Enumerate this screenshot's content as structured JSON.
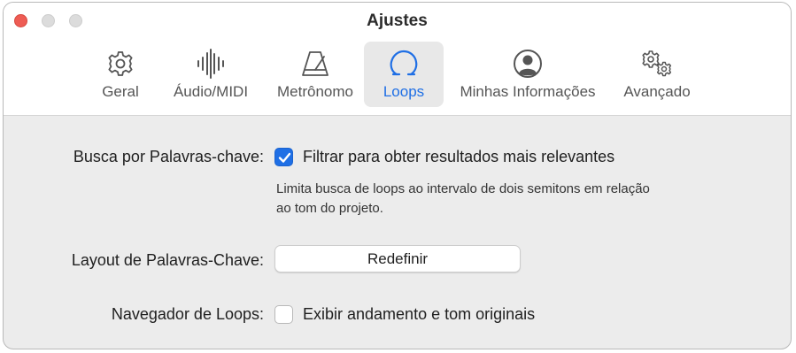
{
  "window": {
    "title": "Ajustes"
  },
  "toolbar": {
    "tabs": [
      {
        "label": "Geral",
        "icon": "gear-icon",
        "active": false
      },
      {
        "label": "Áudio/MIDI",
        "icon": "waveform-icon",
        "active": false
      },
      {
        "label": "Metrônomo",
        "icon": "metronome-icon",
        "active": false
      },
      {
        "label": "Loops",
        "icon": "loop-icon",
        "active": true
      },
      {
        "label": "Minhas Informações",
        "icon": "person-circle-icon",
        "active": false
      },
      {
        "label": "Avançado",
        "icon": "gears-icon",
        "active": false
      }
    ]
  },
  "settings": {
    "keyword_search": {
      "label": "Busca por Palavras-chave:",
      "checkbox_label": "Filtrar para obter resultados mais relevantes",
      "checked": true,
      "help_line1": "Limita busca de loops ao intervalo de dois semitons em relação",
      "help_line2": "ao tom do projeto."
    },
    "keyword_layout": {
      "label": "Layout de Palavras-Chave:",
      "button_label": "Redefinir"
    },
    "loop_browser": {
      "label": "Navegador de Loops:",
      "checkbox_label": "Exibir andamento e tom originais",
      "checked": false
    }
  },
  "colors": {
    "accent": "#1f6fe5",
    "close_button": "#ee5c54",
    "inactive_traffic": "#dcdcdc",
    "content_background": "#ececec"
  }
}
